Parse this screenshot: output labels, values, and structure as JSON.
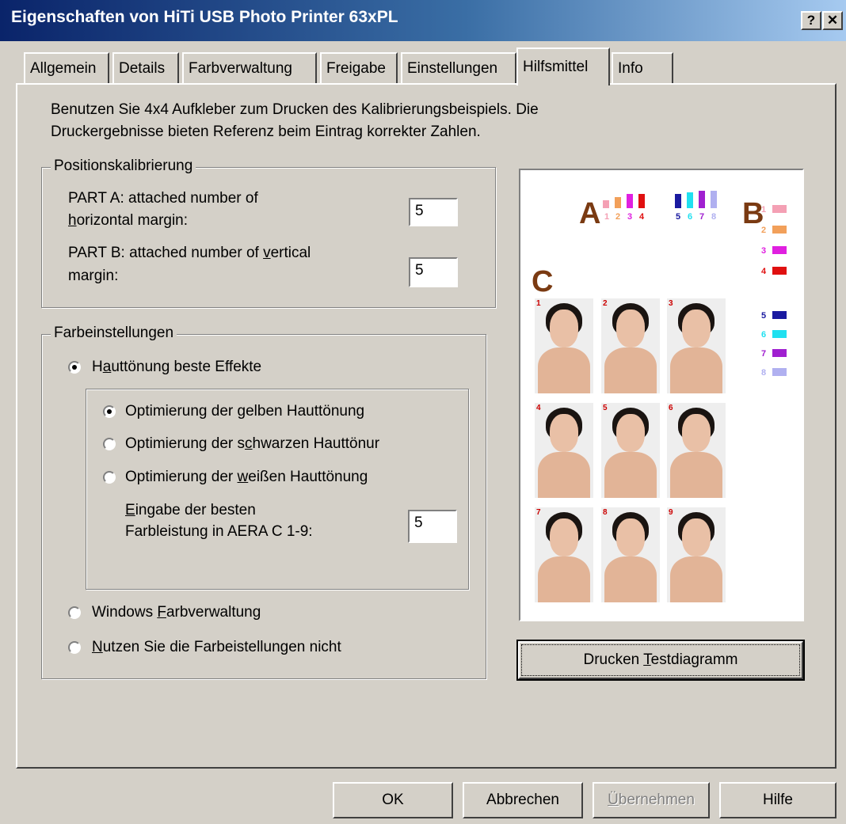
{
  "window": {
    "title": "Eigenschaften von HiTi USB Photo Printer 63xPL",
    "help_button": "?",
    "close_button": "✕"
  },
  "tabs": [
    "Allgemein",
    "Details",
    "Farbverwaltung",
    "Freigabe",
    "Einstellungen",
    "Hilfsmittel",
    "Info"
  ],
  "active_tab": "Hilfsmittel",
  "intro": {
    "line1": "Benutzen Sie 4x4 Aufkleber zum Drucken des Kalibrierungsbeispiels. Die",
    "line2": "Druckergebnisse bieten Referenz beim Eintrag korrekter Zahlen."
  },
  "position": {
    "legend": "Positionskalibrierung",
    "part_a_line1": "PART A: attached number of",
    "part_a_line2_u": "h",
    "part_a_line2": "orizontal margin:",
    "part_a_value": "5",
    "part_b_line1_pre": "PART B: attached number of ",
    "part_b_line1_u": "v",
    "part_b_line1_post": "ertical",
    "part_b_line2": "margin:",
    "part_b_value": "5"
  },
  "color": {
    "legend": "Farbeinstellungen",
    "opt_skin_pre": "H",
    "opt_skin_u": "a",
    "opt_skin_post": "uttönung beste Effekte",
    "sub_yellow_pre": "Optimierung der ",
    "sub_yellow_u": "g",
    "sub_yellow_post": "elben Hauttönung",
    "sub_black_pre": "Optimierung der s",
    "sub_black_u": "c",
    "sub_black_post": "hwarzen Hauttönur",
    "sub_white_pre": "Optimierung der ",
    "sub_white_u": "w",
    "sub_white_post": "eißen Hauttönung",
    "best_u": "E",
    "best_line1": "ingabe der besten",
    "best_line2": "Farbleistung in AERA C 1-9:",
    "best_value": "5",
    "opt_windows_pre": "Windows ",
    "opt_windows_u": "F",
    "opt_windows_post": "arbverwaltung",
    "opt_none_u": "N",
    "opt_none_post": "utzen Sie die Farbeistellungen nicht"
  },
  "preview": {
    "label_a": "A",
    "label_b": "B",
    "label_c": "C",
    "a_numbers": [
      "1",
      "2",
      "3",
      "4",
      "5",
      "6",
      "7",
      "8"
    ],
    "b_numbers": [
      "1",
      "2",
      "3",
      "4",
      "5",
      "6",
      "7",
      "8"
    ],
    "photo_numbers": [
      "1",
      "2",
      "3",
      "4",
      "5",
      "6",
      "7",
      "8",
      "9"
    ],
    "colors": [
      "#f4a0b4",
      "#f2a05a",
      "#e020e0",
      "#e01010",
      "#1a1aa0",
      "#20e0f0",
      "#a020d0",
      "#b0b0f0"
    ]
  },
  "print_button": {
    "pre": "Drucken ",
    "u": "T",
    "post": "estdiagramm"
  },
  "footer": {
    "ok": "OK",
    "cancel": "Abbrechen",
    "apply_u": "Ü",
    "apply_post": "bernehmen",
    "help": "Hilfe"
  }
}
